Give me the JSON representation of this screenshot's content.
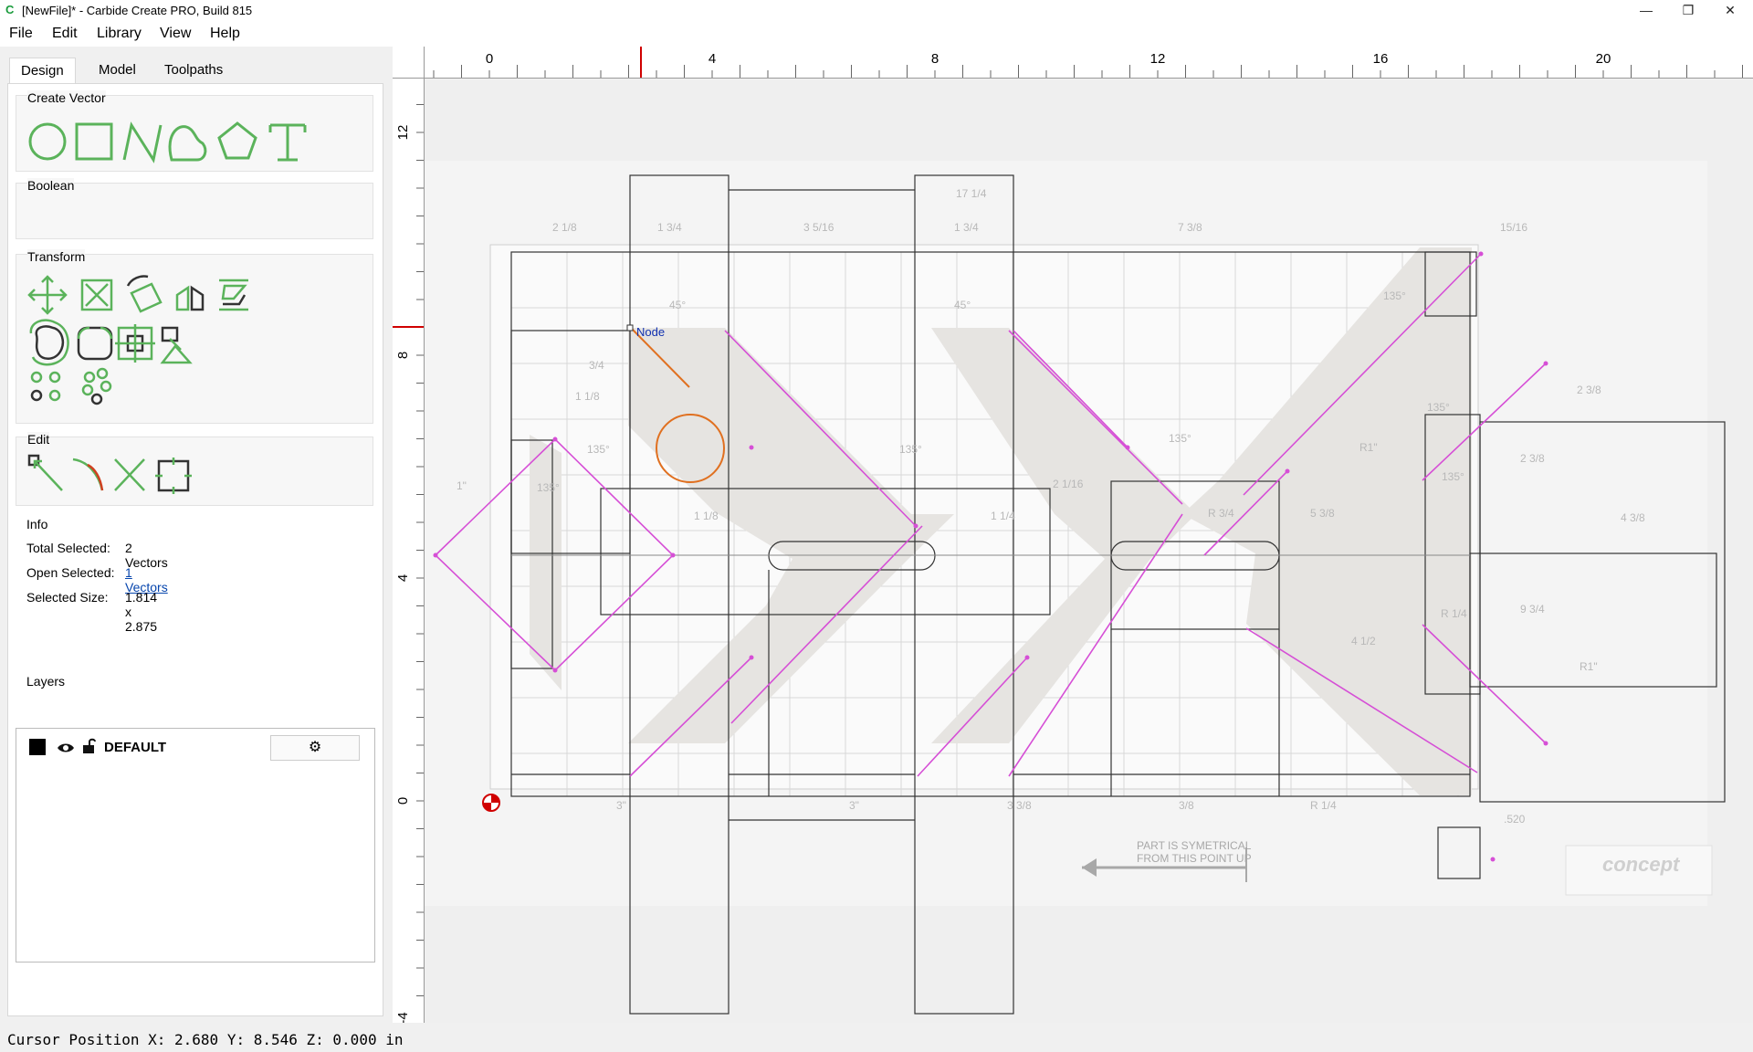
{
  "window": {
    "title": "[NewFile]* - Carbide Create PRO, Build 815",
    "icon": "carbide-c-icon",
    "controls": [
      "minimize-icon",
      "restore-icon",
      "close-icon"
    ]
  },
  "menu": {
    "items": [
      "File",
      "Edit",
      "Library",
      "View",
      "Help"
    ]
  },
  "tabs": [
    "Design",
    "Model",
    "Toolpaths"
  ],
  "panel": {
    "create_vector": {
      "title": "Create Vector",
      "tools": [
        "circle-icon",
        "rectangle-icon",
        "polyline-icon",
        "curve-icon",
        "polygon-icon",
        "text-icon"
      ]
    },
    "boolean": {
      "title": "Boolean"
    },
    "transform": {
      "title": "Transform",
      "tools": [
        "move-icon",
        "scale-icon",
        "rotate-icon",
        "mirror-icon",
        "align-icon",
        "offset-icon",
        "fillet-icon",
        "center-icon",
        "pattern-icon",
        "circular-array-icon",
        "linear-array-icon"
      ]
    },
    "edit": {
      "title": "Edit",
      "tools": [
        "node-edit-icon",
        "trim-curve-icon",
        "cut-icon",
        "bounding-box-icon"
      ]
    },
    "info": {
      "title": "Info",
      "total_selected_label": "Total Selected:",
      "total_selected_value": "2 Vectors",
      "open_selected_label": "Open Selected:",
      "open_selected_value": "1 Vectors",
      "selected_size_label": "Selected Size:",
      "selected_size_value": "1.814 x 2.875"
    },
    "layers": {
      "title": "Layers",
      "items": [
        {
          "name": "DEFAULT",
          "color": "#000000"
        }
      ]
    }
  },
  "ruler": {
    "top_labels": [
      "0",
      "4",
      "8",
      "12",
      "16",
      "20"
    ],
    "left_labels": [
      "12",
      "8",
      "4",
      "0",
      "-4"
    ]
  },
  "canvas": {
    "node_label": "Node",
    "note_line1": "PART IS SYMETRICAL",
    "note_line2": "FROM THIS POINT UP",
    "watermark": "concept",
    "dim_labels": [
      "2 1/8",
      "1 3/4",
      "3 5/16",
      "1 3/4",
      "17 1/4",
      "7 3/8",
      "15/16",
      "45°",
      "45°",
      "135°",
      "135°",
      "135°",
      "135°",
      "135°",
      "135°",
      "135°",
      "R 1/4",
      "3/4",
      "1 1/8",
      "1 1/8",
      "1 1/4",
      "5 3/8",
      "2 3/8",
      "2 3/8",
      "9 3/4",
      "4 3/8",
      "R1\"",
      "R1\"",
      "4 1/2",
      "3\"",
      "3\"",
      "3/8",
      "3 3/8",
      "R 1/4",
      ".520",
      "R 3/4",
      "2 1/16",
      "1\""
    ]
  },
  "colors": {
    "accent_green": "#5bb35b",
    "selection_magenta": "#d64fd6",
    "selected_orange": "#e07020",
    "link_blue": "#0645ad",
    "ruler_marker": "#d00000"
  },
  "status": {
    "cursor": "Cursor Position X: 2.680 Y: 8.546 Z: 0.000 in"
  }
}
